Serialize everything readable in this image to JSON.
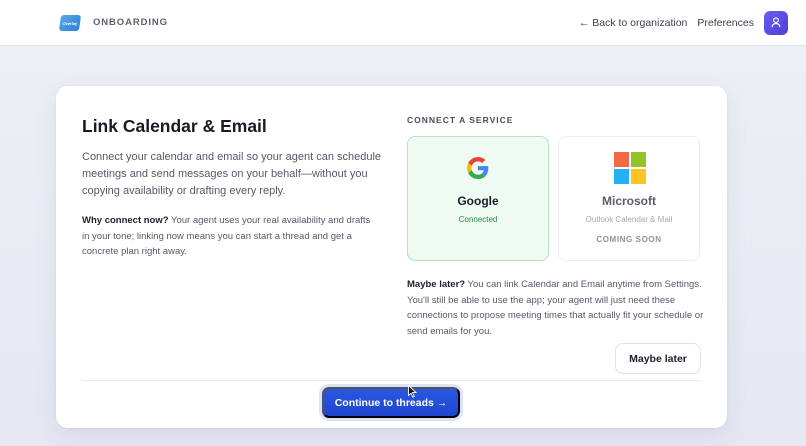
{
  "header": {
    "logo_text": "Overlay",
    "section": "ONBOARDING",
    "back_link": "← Back to organization",
    "preferences": "Preferences",
    "avatar_icon": "user-icon"
  },
  "main": {
    "title": "Link Calendar & Email",
    "description": "Connect your calendar and email so your agent can schedule meetings and send messages on your behalf—without you copying availability or drafting every reply.",
    "why_label": "Why connect now?",
    "why_text": " Your agent uses your real availability and drafts in your tone; linking now means you can start a thread and get a concrete plan right away."
  },
  "services": {
    "section_label": "CONNECT A SERVICE",
    "google": {
      "name": "Google",
      "status": "Connected",
      "icon": "google-icon"
    },
    "microsoft": {
      "name": "Microsoft",
      "subtitle": "Outlook Calendar & Mail",
      "status": "COMING SOON",
      "icon": "microsoft-icon"
    }
  },
  "later": {
    "label": "Maybe later?",
    "text": " You can link Calendar and Email anytime from Settings. You'll still be able to use the app; your agent will just need these connections to propose meeting times that actually fit your schedule or send emails for you.",
    "button": "Maybe later"
  },
  "footer": {
    "continue": "Continue to threads →"
  },
  "colors": {
    "accent": "#2a57e0",
    "connected": "#1f8a4c",
    "avatar": "#5b4de6"
  }
}
